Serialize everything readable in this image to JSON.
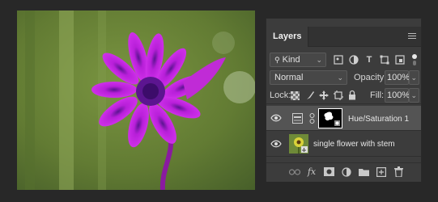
{
  "panel": {
    "close_glyph": "×",
    "collapse_glyph": "‹‹",
    "tab_label": "Layers",
    "filter": {
      "kind_label": "Kind",
      "icons": [
        "pixel-filter-icon",
        "adjustment-filter-icon",
        "type-filter-icon",
        "shape-filter-icon",
        "smart-object-filter-icon"
      ]
    },
    "blend": {
      "mode": "Normal",
      "opacity_label": "Opacity:",
      "opacity_value": "100%"
    },
    "lock": {
      "label": "Lock:",
      "fill_label": "Fill:",
      "fill_value": "100%"
    },
    "layers": [
      {
        "name": "Hue/Saturation 1",
        "type": "adjustment",
        "selected": true,
        "visible": true
      },
      {
        "name": "single flower with stem",
        "type": "smart-object",
        "selected": false,
        "visible": true
      }
    ],
    "bottom_icons": [
      "link-icon",
      "fx-icon",
      "mask-icon",
      "adjustment-icon",
      "group-icon",
      "new-layer-icon",
      "trash-icon"
    ]
  },
  "glyphs": {
    "fx": "fx",
    "type": "T",
    "chevron": "⌄"
  },
  "colors": {
    "panel_bg": "#3c3c3c",
    "selected_row": "#545454",
    "flower": "#c61fe0",
    "background_green": "#6f8a3c"
  }
}
